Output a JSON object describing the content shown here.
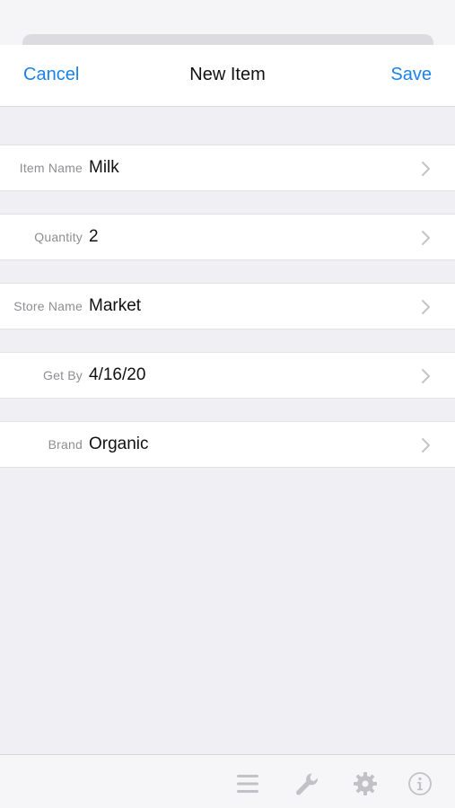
{
  "nav": {
    "cancel_label": "Cancel",
    "title": "New Item",
    "save_label": "Save"
  },
  "form": {
    "rows": [
      {
        "label": "Item Name",
        "value": "Milk"
      },
      {
        "label": "Quantity",
        "value": "2"
      },
      {
        "label": "Store Name",
        "value": "Market"
      },
      {
        "label": "Get By",
        "value": "4/16/20"
      },
      {
        "label": "Brand",
        "value": "Organic"
      }
    ]
  },
  "toolbar": {
    "icons": [
      "list-icon",
      "wrench-icon",
      "gear-icon",
      "info-icon"
    ]
  },
  "colors": {
    "accent": "#1a82e8",
    "background": "#efeff4",
    "label": "#8e8e93"
  }
}
